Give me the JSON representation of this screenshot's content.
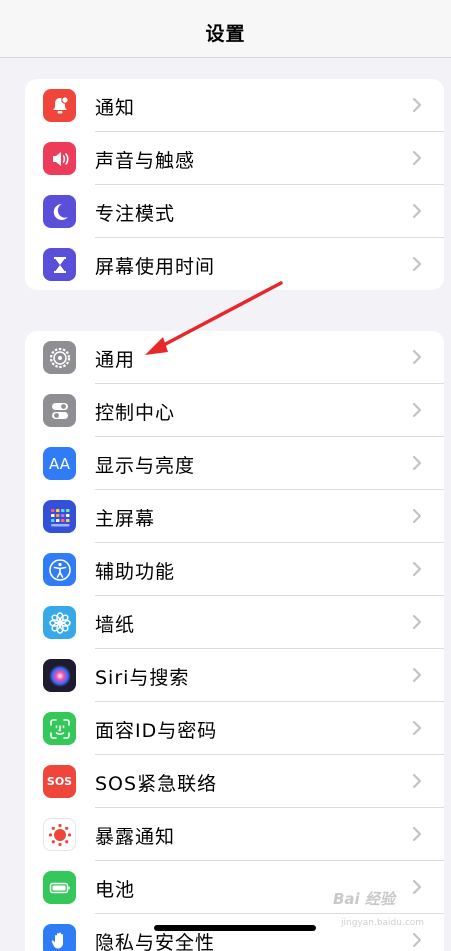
{
  "nav": {
    "title": "设置"
  },
  "group1": [
    {
      "label": "通知",
      "icon": "notification-bell-icon",
      "color": "#f0453a"
    },
    {
      "label": "声音与触感",
      "icon": "speaker-icon",
      "color": "#ed3b5a"
    },
    {
      "label": "专注模式",
      "icon": "moon-icon",
      "color": "#5a4fd8"
    },
    {
      "label": "屏幕使用时间",
      "icon": "hourglass-icon",
      "color": "#5a4fd8"
    }
  ],
  "group2": [
    {
      "label": "通用",
      "icon": "gear-icon",
      "color": "#8e8e93"
    },
    {
      "label": "控制中心",
      "icon": "toggles-icon",
      "color": "#8e8e93"
    },
    {
      "label": "显示与亮度",
      "icon": "aa-text-icon",
      "icon_text": "AA",
      "color": "#2f7cf6"
    },
    {
      "label": "主屏幕",
      "icon": "home-grid-icon",
      "color": "#3550d8"
    },
    {
      "label": "辅助功能",
      "icon": "accessibility-icon",
      "color": "#2f7cf6"
    },
    {
      "label": "墙纸",
      "icon": "flower-icon",
      "color": "#38a9e8"
    },
    {
      "label": "Siri与搜索",
      "icon": "siri-icon",
      "color": "#1c1c2e"
    },
    {
      "label": "面容ID与密码",
      "icon": "face-id-icon",
      "color": "#34c759"
    },
    {
      "label": "SOS紧急联络",
      "icon": "sos-icon",
      "icon_text": "SOS",
      "color": "#f0453a"
    },
    {
      "label": "暴露通知",
      "icon": "exposure-icon",
      "color": "#ffffff"
    },
    {
      "label": "电池",
      "icon": "battery-icon",
      "color": "#34c759"
    },
    {
      "label": "隐私与安全性",
      "icon": "hand-icon",
      "color": "#2f7cf6"
    }
  ],
  "watermark": {
    "text": "Bai 经验",
    "sub": "jingyan.baidu.com"
  }
}
